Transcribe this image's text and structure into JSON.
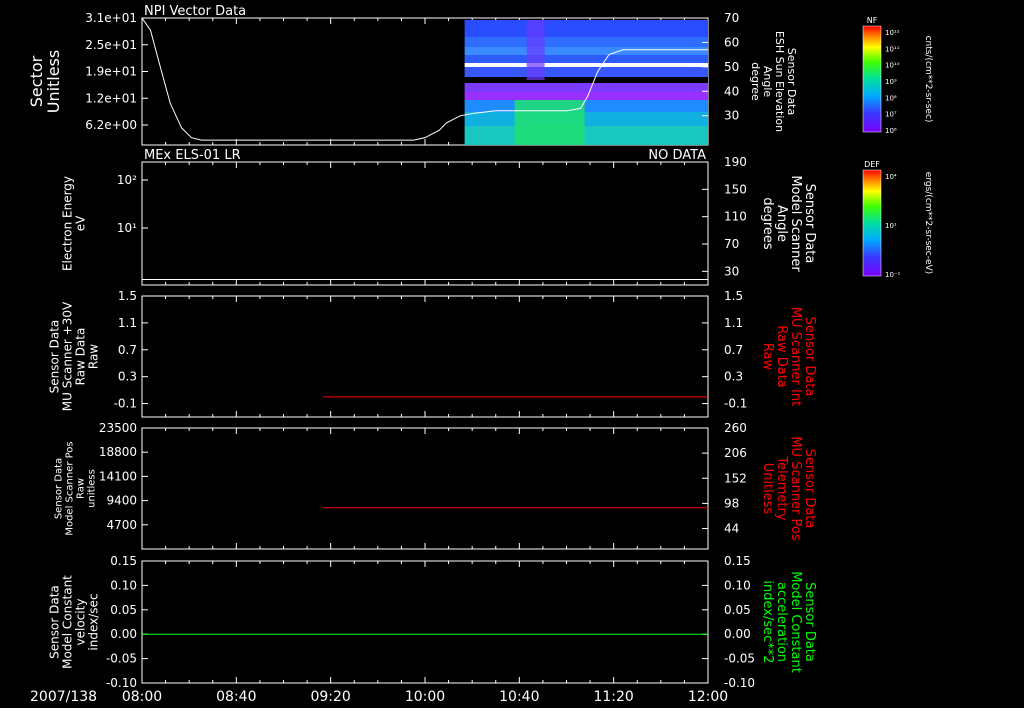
{
  "time_axis": {
    "date_label": "2007/138",
    "ticks": [
      "08:00",
      "08:40",
      "09:20",
      "10:00",
      "10:40",
      "11:20",
      "12:00"
    ],
    "range_hours": [
      8,
      12
    ]
  },
  "colorbars": [
    {
      "label": "NF",
      "units": "cnts/(cm**2-sr-sec)",
      "ticks": [
        "10¹²",
        "10¹¹",
        "10¹⁰",
        "10⁹",
        "10⁸",
        "10⁷",
        "10⁶"
      ]
    },
    {
      "label": "DEF",
      "units": "ergs/(cm**2-sr-sec-eV)",
      "ticks": [
        "10⁴",
        "10¹",
        "10⁻¹"
      ]
    }
  ],
  "chart_data": [
    {
      "type": "heatmap",
      "title": "NPI Vector Data",
      "right_title": "",
      "ylabel": [
        "Sector",
        "Unitless"
      ],
      "yticks_left": [
        "3.1e+01",
        "2.5e+01",
        "1.9e+01",
        "1.2e+01",
        "6.2e+00"
      ],
      "ylabel_right": [
        "Sensor Data",
        "ESH Sun Elevation",
        "Angle",
        "degree"
      ],
      "right_label_color": "#ffffff",
      "yticks_right": [
        "70",
        "60",
        "50",
        "40",
        "30"
      ],
      "ylim_right": [
        18,
        70
      ],
      "line_color": "#ffffff",
      "line_series": {
        "name": "",
        "x": [
          8.0,
          8.06,
          8.12,
          8.2,
          8.28,
          8.35,
          8.42,
          9.5,
          9.8,
          9.92,
          10.0,
          10.1,
          10.15,
          10.25,
          10.35,
          10.5,
          11.0,
          11.1,
          11.15,
          11.22,
          11.3,
          11.4,
          11.45,
          12.0
        ],
        "y": [
          70,
          65,
          52,
          35,
          25,
          21,
          20,
          20,
          20,
          20,
          21,
          24,
          27,
          30,
          31,
          32,
          32,
          33,
          38,
          48,
          55,
          57,
          57,
          57
        ]
      },
      "heatmap_x_start": 10.28
    },
    {
      "type": "line",
      "title": "MEx ELS-01 LR",
      "right_title": "NO DATA",
      "ylabel": [
        "Electron Energy",
        "eV"
      ],
      "yticks_left": [
        "10²",
        "10¹"
      ],
      "ylabel_right": [
        "Sensor Data",
        "Model Scanner",
        "Angle",
        "degrees"
      ],
      "right_label_color": "#ffffff",
      "yticks_right": [
        "190",
        "150",
        "110",
        "70",
        "30"
      ],
      "ylim_right": [
        10,
        190
      ],
      "line_color": "#ffffff",
      "line_series": {
        "name": "",
        "x": [
          8.0,
          12.0
        ],
        "y": [
          18,
          18
        ]
      }
    },
    {
      "type": "line",
      "title": "",
      "right_title": "",
      "ylabel": [
        "Sensor Data",
        "MU Scanner +30V",
        "Raw Data",
        "Raw"
      ],
      "yticks_left": [
        "1.5",
        "1.1",
        "0.7",
        "0.3",
        "-0.1"
      ],
      "ylim_left": [
        -0.3,
        1.5
      ],
      "ylabel_right": [
        "Sensor Data",
        "MU Scanner Int",
        "Raw Data",
        "Raw"
      ],
      "right_label_color": "#ff0000",
      "yticks_right": [
        "1.5",
        "1.1",
        "0.7",
        "0.3",
        "-0.1"
      ],
      "ylim_right": [
        -0.3,
        1.5
      ],
      "line_color": "#ff0000",
      "line_series": {
        "name": "",
        "x": [
          9.28,
          12.0
        ],
        "y": [
          0.0,
          0.0
        ]
      }
    },
    {
      "type": "line",
      "title": "",
      "right_title": "",
      "ylabel": [
        "Sensor Data",
        "Model Scanner Pos",
        "Raw",
        "unitless"
      ],
      "yticks_left": [
        "23500",
        "18800",
        "14100",
        "9400",
        "4700"
      ],
      "ylim_left": [
        0,
        23500
      ],
      "ylabel_right": [
        "Sensor Data",
        "MU Scanner Pos",
        "Telemetry",
        "Unitless"
      ],
      "right_label_color": "#ff0000",
      "yticks_right": [
        "260",
        "206",
        "152",
        "98",
        "44"
      ],
      "ylim_right": [
        0,
        260
      ],
      "line_color": "#ff0000",
      "line_series": {
        "name": "",
        "x": [
          9.28,
          12.0
        ],
        "y": [
          8000,
          8000
        ]
      }
    },
    {
      "type": "line",
      "title": "",
      "right_title": "",
      "ylabel": [
        "Sensor Data",
        "Model Constant",
        "velocity",
        "index/sec"
      ],
      "yticks_left": [
        "0.15",
        "0.10",
        "0.05",
        "0.00",
        "-0.05",
        "-0.10"
      ],
      "ylim_left": [
        -0.1,
        0.15
      ],
      "ylabel_right": [
        "Sensor Data",
        "Model Constant",
        "acceleration",
        "index/sec**2"
      ],
      "right_label_color": "#00ff00",
      "yticks_right": [
        "0.15",
        "0.10",
        "0.05",
        "0.00",
        "-0.05",
        "-0.10"
      ],
      "ylim_right": [
        -0.1,
        0.15
      ],
      "line_color": "#00ff00",
      "line_series": {
        "name": "",
        "x": [
          8.0,
          12.0
        ],
        "y": [
          0.0,
          0.0
        ]
      }
    }
  ]
}
